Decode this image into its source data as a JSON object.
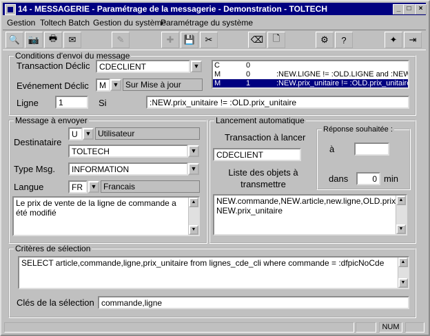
{
  "window": {
    "title": "14 - MESSAGERIE - Paramétrage de la messagerie - Demonstration - TOLTECH",
    "controls": {
      "minimize": "_",
      "maximize": "□",
      "close": "×"
    }
  },
  "menu": [
    "Gestion",
    "Toltech Batch",
    "Gestion du système",
    "Paramétrage du système"
  ],
  "toolbar": {
    "buttons": [
      {
        "name": "search-icon",
        "glyph": "🔍"
      },
      {
        "name": "camera-icon",
        "glyph": "📷"
      },
      {
        "name": "printer-icon",
        "glyph": "🖶"
      },
      {
        "name": "mail-icon",
        "glyph": "✉"
      },
      {
        "name": "edit-icon",
        "glyph": "✎"
      },
      {
        "name": "add-icon",
        "glyph": "✚"
      },
      {
        "name": "save-icon",
        "glyph": "💾"
      },
      {
        "name": "cut-icon",
        "glyph": "✂"
      },
      {
        "name": "eraser-icon",
        "glyph": "⌫"
      },
      {
        "name": "new-document-icon",
        "glyph": "🗋"
      },
      {
        "name": "network-icon",
        "glyph": "⚙"
      },
      {
        "name": "help-icon",
        "glyph": "?"
      },
      {
        "name": "settings-icon",
        "glyph": "✦"
      },
      {
        "name": "exit-icon",
        "glyph": "⇥"
      }
    ]
  },
  "conditions": {
    "legend": "Conditions d'envoi du message",
    "transaction_label": "Transaction Déclic",
    "transaction_value": "CDECLIENT",
    "evenement_label": "Evénement Déclic",
    "evenement_code": "M",
    "evenement_desc": "Sur Mise à jour",
    "ligne_label": "Ligne",
    "ligne_value": "1",
    "si_label": "Si",
    "si_value": ":NEW.prix_unitaire != :OLD.prix_unitaire",
    "list": [
      {
        "code": "C",
        "num": "0",
        "expr": ""
      },
      {
        "code": "M",
        "num": "0",
        "expr": ":NEW.LIGNE != :OLD.LIGNE and :NEW.L"
      },
      {
        "code": "M",
        "num": "1",
        "expr": ":NEW.prix_unitaire != :OLD.prix_unitaire"
      }
    ]
  },
  "message": {
    "legend": "Message à envoyer",
    "destinataire_label": "Destinataire",
    "dest_code": "U",
    "dest_desc": "Utilisateur",
    "dest_value": "TOLTECH",
    "type_label": "Type Msg.",
    "type_value": "INFORMATION",
    "langue_label": "Langue",
    "langue_code": "FR",
    "langue_desc": "Francais",
    "body": "Le prix de vente de la ligne de commande a été modifié"
  },
  "lancement": {
    "legend": "Lancement automatique",
    "transaction_label": "Transaction à lancer",
    "transaction_value": "CDECLIENT",
    "liste_label": "Liste des objets à transmettre",
    "liste_value": "NEW.commande,NEW.article,new.ligne,OLD.prix_unitaire, NEW.prix_unitaire",
    "reponse_legend": "Réponse souhaitée :",
    "a_label": "à",
    "a_value": "",
    "dans_label": "dans",
    "dans_value": "0",
    "min_label": "min"
  },
  "criteres": {
    "legend": "Critères de sélection",
    "sql": "SELECT article,commande,ligne,prix_unitaire from lignes_cde_cli where commande = :dfpicNoCde",
    "cles_label": "Clés de la sélection",
    "cles_value": "commande,ligne"
  },
  "status": {
    "num": "NUM"
  }
}
